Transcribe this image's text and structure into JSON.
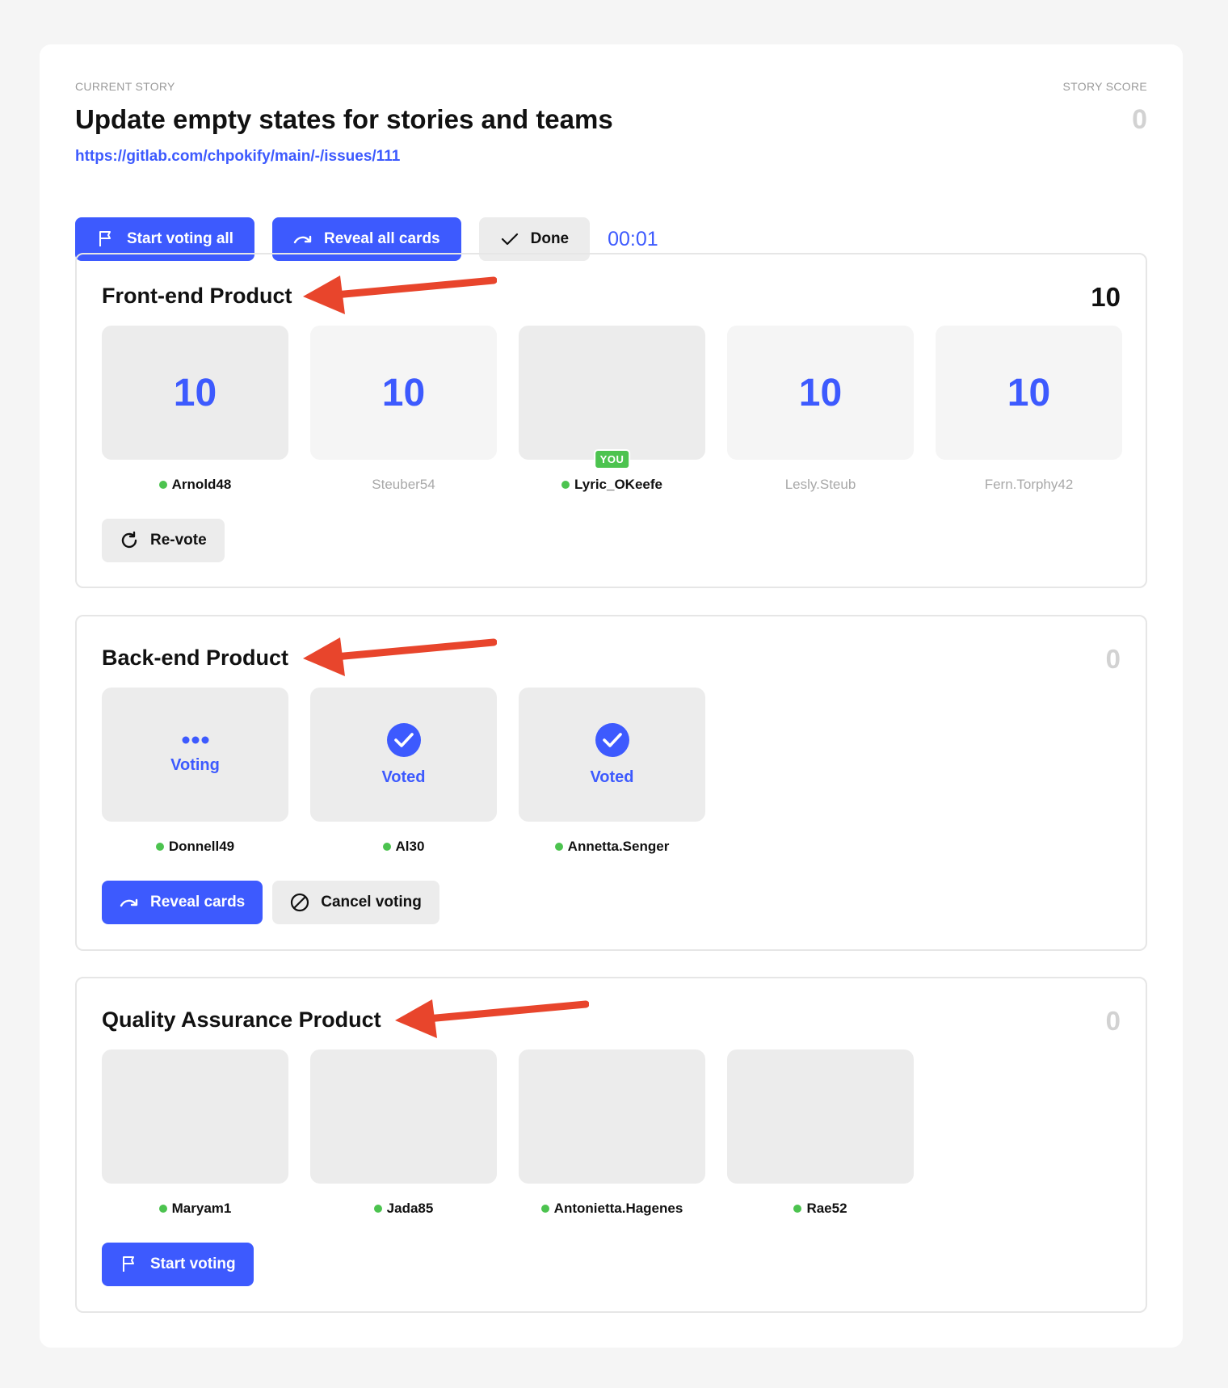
{
  "story": {
    "label": "CURRENT STORY",
    "title": "Update empty states for stories and teams",
    "link": "https://gitlab.com/chpokify/main/-/issues/111",
    "score_label": "STORY SCORE",
    "score": "0"
  },
  "toolbar": {
    "start_voting_all": "Start voting all",
    "reveal_all_cards": "Reveal all cards",
    "done": "Done",
    "timer": "00:01"
  },
  "teams": [
    {
      "name": "Front-end Product",
      "score": "10",
      "members": [
        {
          "name": "Arnold48",
          "card": "10",
          "online": true
        },
        {
          "name": "Steuber54",
          "card": "10",
          "online": false
        },
        {
          "name": "Lyric_OKeefe",
          "card": "",
          "online": true,
          "badge": "YOU"
        },
        {
          "name": "Lesly.Steub",
          "card": "10",
          "online": false
        },
        {
          "name": "Fern.Torphy42",
          "card": "10",
          "online": false
        }
      ],
      "actions": {
        "revote": "Re-vote"
      }
    },
    {
      "name": "Back-end Product",
      "score": "0",
      "members": [
        {
          "name": "Donnell49",
          "status": "Voting",
          "online": true
        },
        {
          "name": "Al30",
          "status": "Voted",
          "online": true
        },
        {
          "name": "Annetta.Senger",
          "status": "Voted",
          "online": true
        }
      ],
      "actions": {
        "reveal": "Reveal cards",
        "cancel": "Cancel voting"
      }
    },
    {
      "name": "Quality Assurance Product",
      "score": "0",
      "members": [
        {
          "name": "Maryam1",
          "online": true
        },
        {
          "name": "Jada85",
          "online": true
        },
        {
          "name": "Antonietta.Hagenes",
          "online": true
        },
        {
          "name": "Rae52",
          "online": true
        }
      ],
      "actions": {
        "start": "Start voting"
      }
    }
  ],
  "colors": {
    "accent": "#3d5afe",
    "online": "#4cc34f",
    "annotation": "#e8452c"
  },
  "icons": [
    "flag-icon",
    "redo-arrow-icon",
    "check-icon",
    "refresh-icon",
    "ellipsis-icon",
    "check-circle-icon",
    "cancel-icon",
    "annotation-arrow-icon"
  ]
}
